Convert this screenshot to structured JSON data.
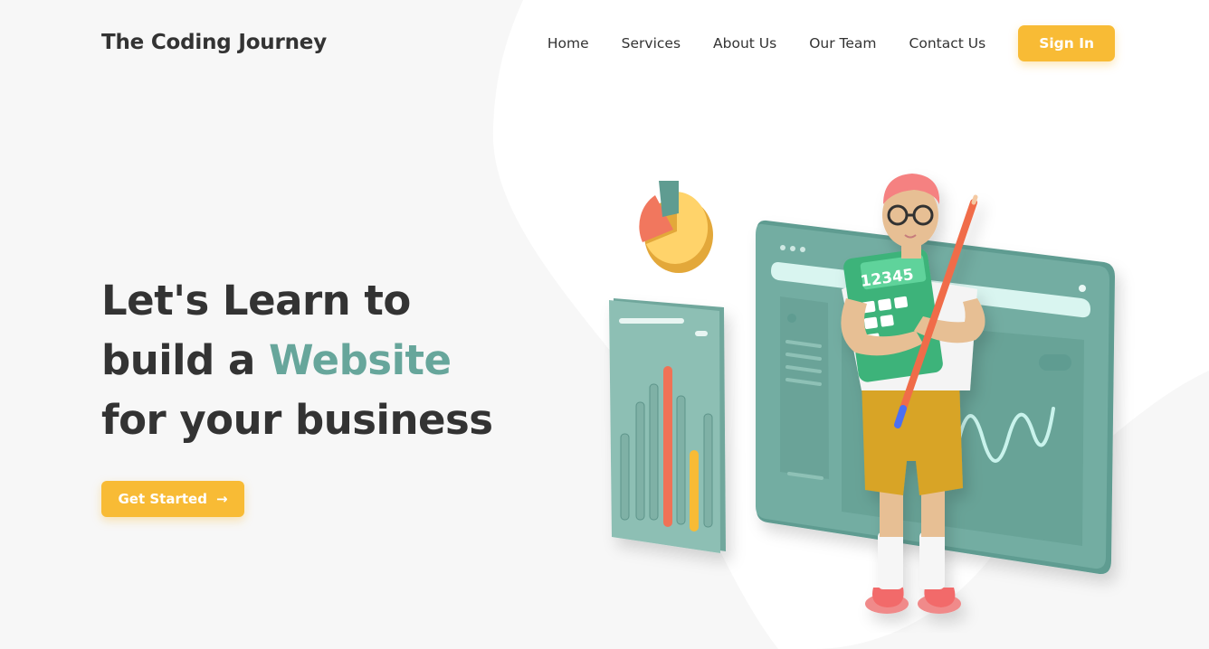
{
  "brand": {
    "name": "The Coding Journey"
  },
  "nav": {
    "items": [
      {
        "label": "Home"
      },
      {
        "label": "Services"
      },
      {
        "label": "About Us"
      },
      {
        "label": "Our Team"
      },
      {
        "label": "Contact Us"
      }
    ],
    "signin_label": "Sign In"
  },
  "hero": {
    "line1": "Let's Learn to",
    "line2_prefix": "build a ",
    "line2_accent": "Website",
    "line3": "for your business",
    "cta_label": "Get Started",
    "cta_icon": "arrow-right-icon"
  },
  "illustration": {
    "calculator_text": "12345"
  },
  "colors": {
    "accent_yellow": "#f8bb35",
    "accent_teal": "#67a69b",
    "text_dark": "#333333",
    "background": "#f7f7f7"
  }
}
